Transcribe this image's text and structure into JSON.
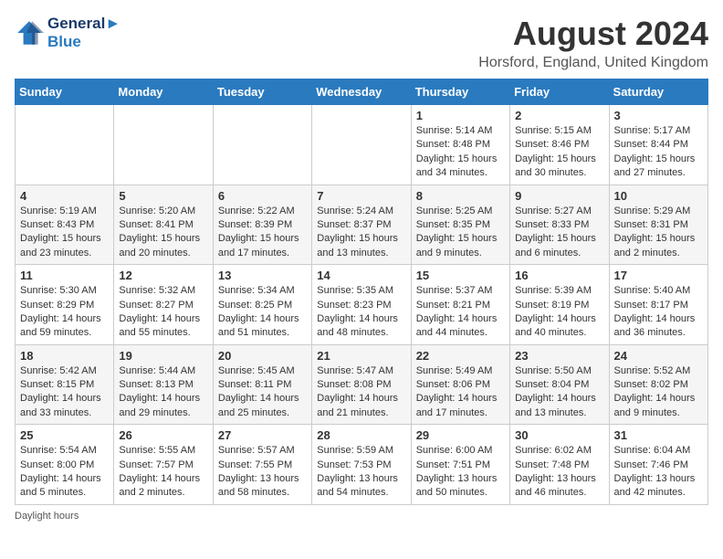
{
  "header": {
    "logo_line1": "General",
    "logo_line2": "Blue",
    "month_year": "August 2024",
    "location": "Horsford, England, United Kingdom"
  },
  "days_of_week": [
    "Sunday",
    "Monday",
    "Tuesday",
    "Wednesday",
    "Thursday",
    "Friday",
    "Saturday"
  ],
  "weeks": [
    [
      {
        "day": "",
        "info": ""
      },
      {
        "day": "",
        "info": ""
      },
      {
        "day": "",
        "info": ""
      },
      {
        "day": "",
        "info": ""
      },
      {
        "day": "1",
        "info": "Sunrise: 5:14 AM\nSunset: 8:48 PM\nDaylight: 15 hours and 34 minutes."
      },
      {
        "day": "2",
        "info": "Sunrise: 5:15 AM\nSunset: 8:46 PM\nDaylight: 15 hours and 30 minutes."
      },
      {
        "day": "3",
        "info": "Sunrise: 5:17 AM\nSunset: 8:44 PM\nDaylight: 15 hours and 27 minutes."
      }
    ],
    [
      {
        "day": "4",
        "info": "Sunrise: 5:19 AM\nSunset: 8:43 PM\nDaylight: 15 hours and 23 minutes."
      },
      {
        "day": "5",
        "info": "Sunrise: 5:20 AM\nSunset: 8:41 PM\nDaylight: 15 hours and 20 minutes."
      },
      {
        "day": "6",
        "info": "Sunrise: 5:22 AM\nSunset: 8:39 PM\nDaylight: 15 hours and 17 minutes."
      },
      {
        "day": "7",
        "info": "Sunrise: 5:24 AM\nSunset: 8:37 PM\nDaylight: 15 hours and 13 minutes."
      },
      {
        "day": "8",
        "info": "Sunrise: 5:25 AM\nSunset: 8:35 PM\nDaylight: 15 hours and 9 minutes."
      },
      {
        "day": "9",
        "info": "Sunrise: 5:27 AM\nSunset: 8:33 PM\nDaylight: 15 hours and 6 minutes."
      },
      {
        "day": "10",
        "info": "Sunrise: 5:29 AM\nSunset: 8:31 PM\nDaylight: 15 hours and 2 minutes."
      }
    ],
    [
      {
        "day": "11",
        "info": "Sunrise: 5:30 AM\nSunset: 8:29 PM\nDaylight: 14 hours and 59 minutes."
      },
      {
        "day": "12",
        "info": "Sunrise: 5:32 AM\nSunset: 8:27 PM\nDaylight: 14 hours and 55 minutes."
      },
      {
        "day": "13",
        "info": "Sunrise: 5:34 AM\nSunset: 8:25 PM\nDaylight: 14 hours and 51 minutes."
      },
      {
        "day": "14",
        "info": "Sunrise: 5:35 AM\nSunset: 8:23 PM\nDaylight: 14 hours and 48 minutes."
      },
      {
        "day": "15",
        "info": "Sunrise: 5:37 AM\nSunset: 8:21 PM\nDaylight: 14 hours and 44 minutes."
      },
      {
        "day": "16",
        "info": "Sunrise: 5:39 AM\nSunset: 8:19 PM\nDaylight: 14 hours and 40 minutes."
      },
      {
        "day": "17",
        "info": "Sunrise: 5:40 AM\nSunset: 8:17 PM\nDaylight: 14 hours and 36 minutes."
      }
    ],
    [
      {
        "day": "18",
        "info": "Sunrise: 5:42 AM\nSunset: 8:15 PM\nDaylight: 14 hours and 33 minutes."
      },
      {
        "day": "19",
        "info": "Sunrise: 5:44 AM\nSunset: 8:13 PM\nDaylight: 14 hours and 29 minutes."
      },
      {
        "day": "20",
        "info": "Sunrise: 5:45 AM\nSunset: 8:11 PM\nDaylight: 14 hours and 25 minutes."
      },
      {
        "day": "21",
        "info": "Sunrise: 5:47 AM\nSunset: 8:08 PM\nDaylight: 14 hours and 21 minutes."
      },
      {
        "day": "22",
        "info": "Sunrise: 5:49 AM\nSunset: 8:06 PM\nDaylight: 14 hours and 17 minutes."
      },
      {
        "day": "23",
        "info": "Sunrise: 5:50 AM\nSunset: 8:04 PM\nDaylight: 14 hours and 13 minutes."
      },
      {
        "day": "24",
        "info": "Sunrise: 5:52 AM\nSunset: 8:02 PM\nDaylight: 14 hours and 9 minutes."
      }
    ],
    [
      {
        "day": "25",
        "info": "Sunrise: 5:54 AM\nSunset: 8:00 PM\nDaylight: 14 hours and 5 minutes."
      },
      {
        "day": "26",
        "info": "Sunrise: 5:55 AM\nSunset: 7:57 PM\nDaylight: 14 hours and 2 minutes."
      },
      {
        "day": "27",
        "info": "Sunrise: 5:57 AM\nSunset: 7:55 PM\nDaylight: 13 hours and 58 minutes."
      },
      {
        "day": "28",
        "info": "Sunrise: 5:59 AM\nSunset: 7:53 PM\nDaylight: 13 hours and 54 minutes."
      },
      {
        "day": "29",
        "info": "Sunrise: 6:00 AM\nSunset: 7:51 PM\nDaylight: 13 hours and 50 minutes."
      },
      {
        "day": "30",
        "info": "Sunrise: 6:02 AM\nSunset: 7:48 PM\nDaylight: 13 hours and 46 minutes."
      },
      {
        "day": "31",
        "info": "Sunrise: 6:04 AM\nSunset: 7:46 PM\nDaylight: 13 hours and 42 minutes."
      }
    ]
  ],
  "footnote": "Daylight hours"
}
